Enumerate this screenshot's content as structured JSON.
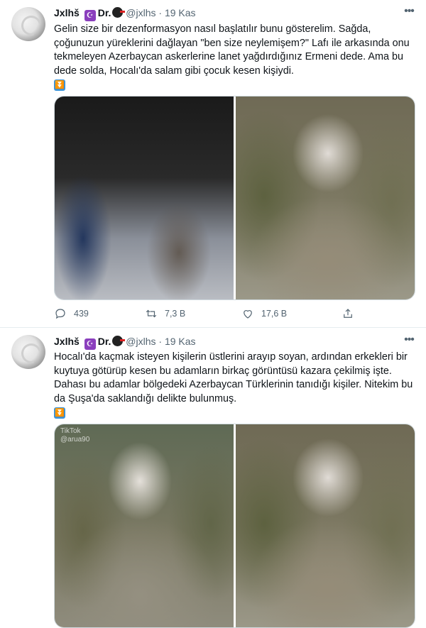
{
  "tweets": [
    {
      "author": {
        "name": "Jxlhš",
        "badge": "☪",
        "suffix": "Dr.",
        "handle": "@jxlhs"
      },
      "separator": "·",
      "date": "19 Kas",
      "more": "•••",
      "text": "Gelin size bir dezenformasyon nasıl başlatılır bunu gösterelim. Sağda, çoğunuzun yüreklerini dağlayan \"ben size neylemişem?\" Lafı ile arkasında onu tekmeleyen Azerbaycan askerlerine lanet yağdırdığınız Ermeni dede. Ama bu dede solda, Hocalı'da salam gibi çocuk kesen kişiydi.",
      "emoji": "⏬",
      "media": [
        {
          "icon": "photo-snow-night"
        },
        {
          "icon": "photo-old-man-soldiers"
        }
      ],
      "actions": {
        "reply": "439",
        "retweet": "7,3 B",
        "like": "17,6 B"
      }
    },
    {
      "author": {
        "name": "Jxlhš",
        "badge": "☪",
        "suffix": "Dr.",
        "handle": "@jxlhs"
      },
      "separator": "·",
      "date": "19 Kas",
      "more": "•••",
      "text": "Hocalı'da kaçmak isteyen kişilerin üstlerini arayıp soyan, ardından erkekleri bir kuytuya götürüp kesen bu adamların birkaç görüntüsü kazara çekilmiş işte. Dahası bu adamlar bölgedeki Azerbaycan Türklerinin tanıdığı kişiler. Nitekim bu da Şuşa'da saklandığı delikte bulunmuş.",
      "emoji": "⏬",
      "media": [
        {
          "icon": "photo-old-man-tiktok",
          "watermark": "TikTok\n@arua90"
        },
        {
          "icon": "photo-old-man-soldiers"
        }
      ]
    }
  ],
  "colors": {
    "text": "#0f1419",
    "muted": "#536471",
    "border": "#cfd9de",
    "divider": "#e6ecf0",
    "badge": "#8a3fbd",
    "emoji": "#3b94d9"
  }
}
